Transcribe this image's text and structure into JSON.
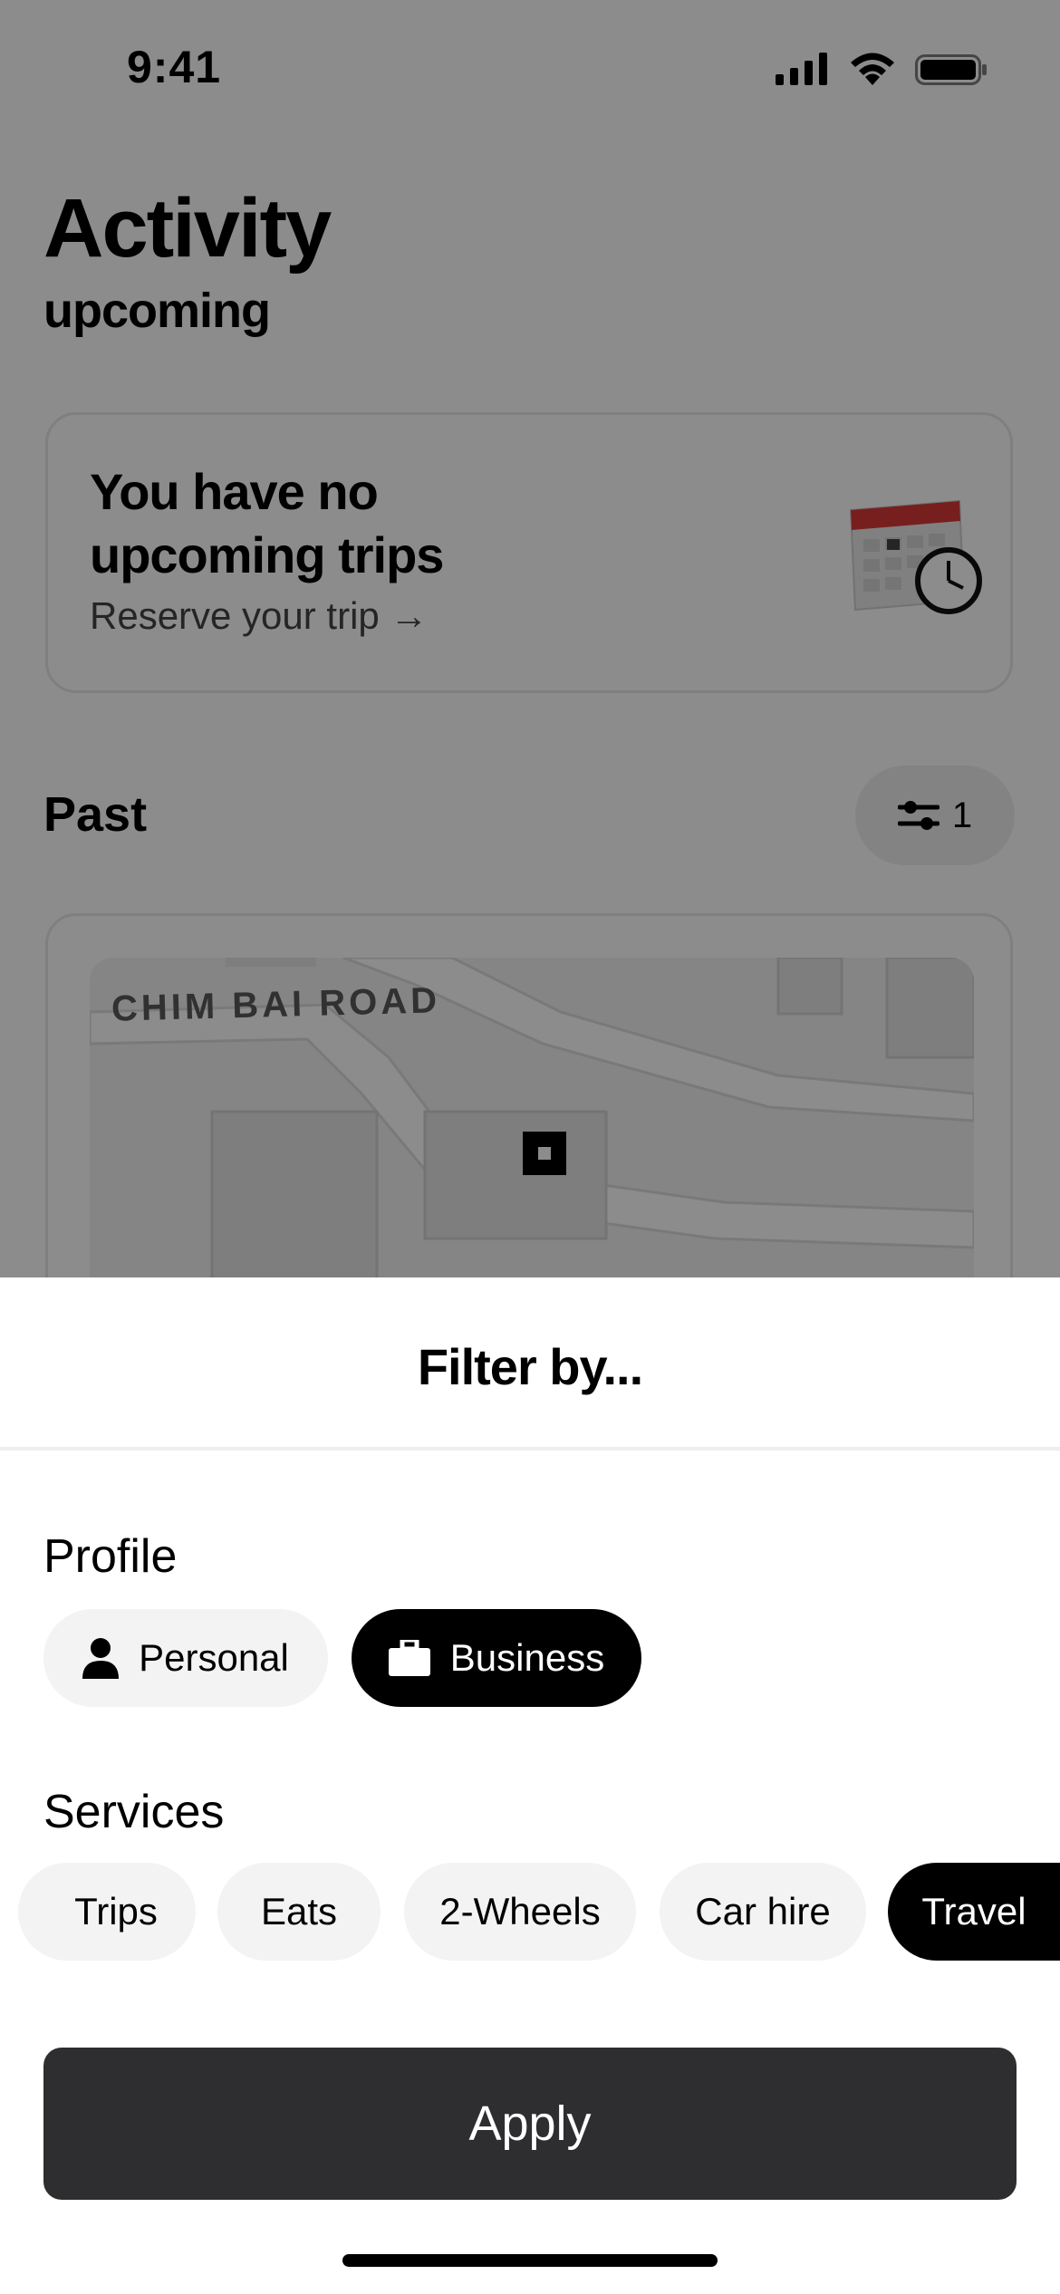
{
  "status_bar": {
    "time": "9:41",
    "icons": [
      "cellular-signal-icon",
      "wifi-icon",
      "battery-icon"
    ]
  },
  "header": {
    "title": "Activity",
    "subtitle": "upcoming"
  },
  "upcoming_card": {
    "title": "You have no upcoming trips",
    "link": "Reserve your trip →",
    "illustration": "calendar-clock-icon"
  },
  "past": {
    "title": "Past",
    "filter_count": "1",
    "filter_icon": "sliders-icon"
  },
  "map": {
    "road_label": "CHIM BAI ROAD"
  },
  "sheet": {
    "title": "Filter by...",
    "profile_label": "Profile",
    "profiles": [
      {
        "label": "Personal",
        "icon": "person-icon",
        "selected": false
      },
      {
        "label": "Business",
        "icon": "briefcase-icon",
        "selected": true
      }
    ],
    "services_label": "Services",
    "services": [
      {
        "label": "Trips",
        "selected": false
      },
      {
        "label": "Eats",
        "selected": false
      },
      {
        "label": "2-Wheels",
        "selected": false
      },
      {
        "label": "Car hire",
        "selected": false
      },
      {
        "label": "Travel",
        "selected": true
      }
    ],
    "apply_label": "Apply"
  },
  "colors": {
    "selected_chip": "#000000",
    "chip": "#f3f3f3",
    "apply_button": "#2e2e31",
    "scrim": "#000000"
  }
}
